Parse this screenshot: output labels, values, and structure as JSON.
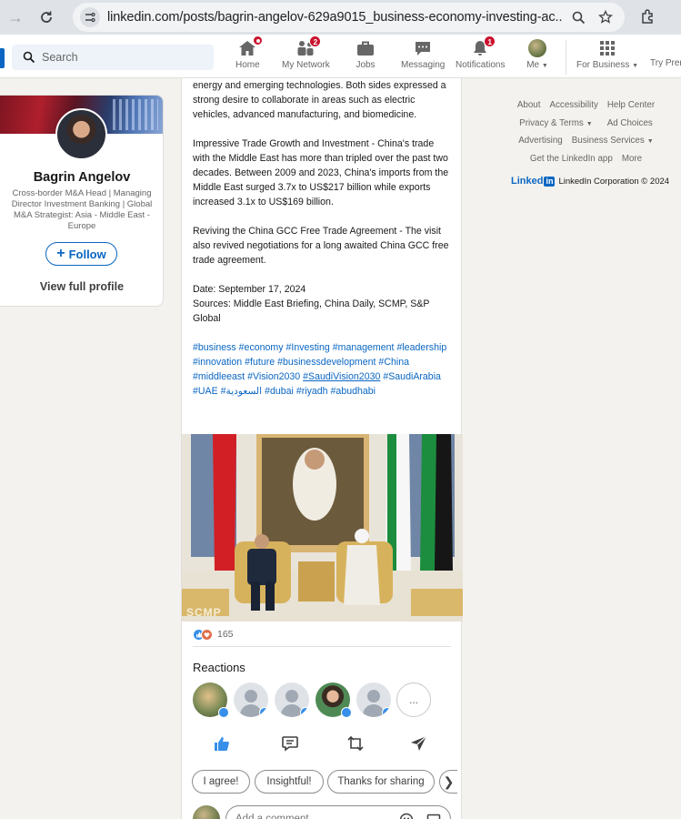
{
  "browser": {
    "url": "linkedin.com/posts/bagrin-angelov-629a9015_business-economy-investing-ac..."
  },
  "nav": {
    "search_placeholder": "Search",
    "items": [
      {
        "label": "Home"
      },
      {
        "label": "My Network",
        "badge": "2"
      },
      {
        "label": "Jobs"
      },
      {
        "label": "Messaging"
      },
      {
        "label": "Notifications",
        "badge": "1"
      },
      {
        "label": "Me"
      },
      {
        "label": "For Business"
      },
      {
        "label": "Try Prem"
      }
    ]
  },
  "profile": {
    "name": "Bagrin Angelov",
    "headline": "Cross-border M&A Head | Managing Director Investment Banking | Global M&A Strategist: Asia - Middle East - Europe",
    "follow_label": "Follow",
    "view_profile_label": "View full profile"
  },
  "post": {
    "paragraphs": [
      "energy and emerging technologies. Both sides expressed a strong desire to collaborate in areas such as electric vehicles, advanced manufacturing, and biomedicine.",
      "Impressive Trade Growth and Investment - China's trade with the Middle East has more than tripled over the past two decades. Between 2009 and 2023, China's imports from the Middle East surged 3.7x to US$217 billion while exports increased 3.1x to US$169 billion.",
      "Reviving the China GCC Free Trade Agreement - The visit also revived negotiations for a long awaited China GCC free trade agreement.",
      "Date: September 17, 2024\nSources: Middle East Briefing, China Daily, SCMP, S&P Global"
    ],
    "hashtags": [
      "#business",
      "#economy",
      "#Investing",
      "#management",
      "#leadership",
      "#innovation",
      "#future",
      "#businessdevelopment",
      "#China",
      "#middleeast",
      "#Vision2030",
      "#SaudiVision2030",
      "#SaudiArabia",
      "#UAE",
      "#السعودية",
      "#dubai",
      "#riyadh",
      "#abudhabi"
    ],
    "image_watermark": "SCMP",
    "reaction_count": "165",
    "reactions_title": "Reactions",
    "more_reactors": "...",
    "chips": [
      "I agree!",
      "Insightful!",
      "Thanks for sharing"
    ],
    "comment_placeholder": "Add a comment..."
  },
  "footer": {
    "rows": [
      [
        "About",
        "Accessibility",
        "Help Center"
      ],
      [
        "Privacy & Terms",
        "Ad Choices"
      ],
      [
        "Advertising",
        "Business Services"
      ],
      [
        "Get the LinkedIn app",
        "More"
      ]
    ],
    "corp": "LinkedIn Corporation © 2024",
    "wordmark": "Linked"
  },
  "colors": {
    "brand": "#0a66c2",
    "badge": "#cb112d",
    "page_bg": "#f4f2ee"
  }
}
